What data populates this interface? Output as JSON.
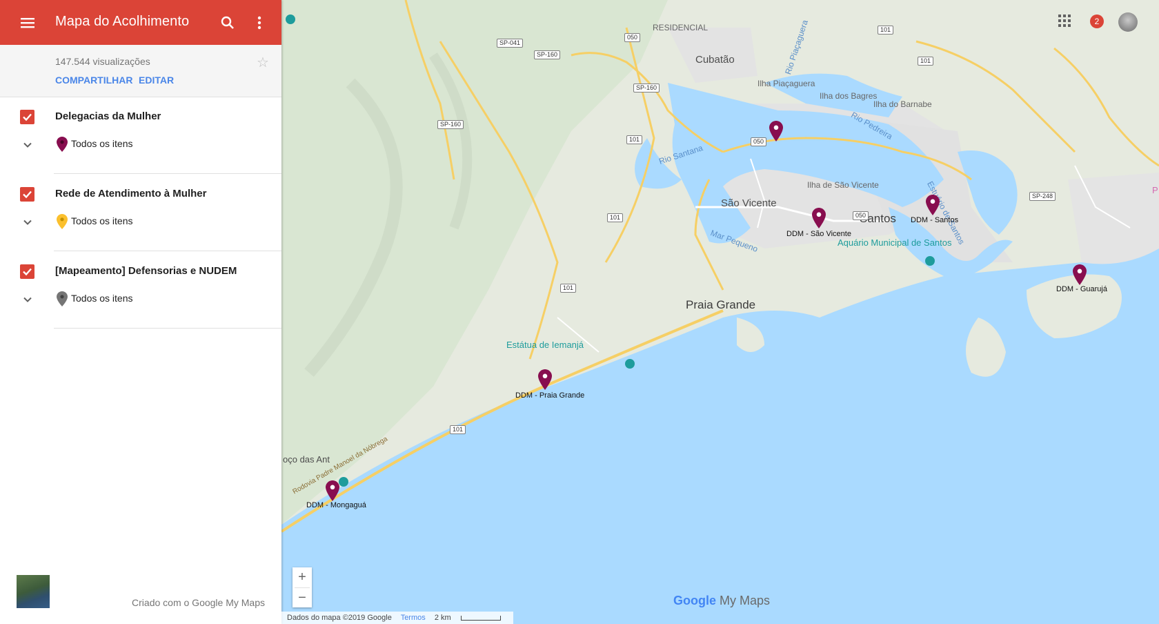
{
  "app": {
    "title": "Mapa do Acolhimento",
    "views": "147.544 visualizações",
    "share_label": "COMPARTILHAR",
    "edit_label": "EDITAR",
    "accent_color": "#db4437",
    "link_color": "#4a86e8"
  },
  "layers": [
    {
      "name": "Delegacias da Mulher",
      "items_label": "Todos os itens",
      "pin_color": "#880e4f",
      "checked": true
    },
    {
      "name": "Rede de Atendimento à Mulher",
      "items_label": "Todos os itens",
      "pin_color": "#fbc02d",
      "checked": true
    },
    {
      "name": "[Mapeamento] Defensorias e NUDEM",
      "items_label": "Todos os itens",
      "pin_color": "#757575",
      "checked": true
    }
  ],
  "sidebar_footer": {
    "credit": "Criado com o Google My Maps"
  },
  "header_controls": {
    "notification_count": "2"
  },
  "map": {
    "places": {
      "residencial": "RESIDENCIAL",
      "cubatao": "Cubatão",
      "ilha_piacaguera": "Ilha Piaçaguera",
      "ilha_bagres": "Ilha dos Bagres",
      "ilha_barnabe": "Ilha do Barnabe",
      "ilha_sao_vicente": "Ilha de São Vicente",
      "sao_vicente": "São Vicente",
      "santos": "Santos",
      "aquario": "Aquário Municipal de Santos",
      "praia_grande": "Praia Grande",
      "estatua": "Estátua de Iemanjá",
      "poco": "oço das Ant",
      "rio_santana": "Rio Santana",
      "rio_piacaguera": "Rio Piaçaguera",
      "rio_pedreira": "Rio Pedreira",
      "estuario": "Estuário de Santos",
      "mar_pequeno": "Mar Pequeno",
      "rodovia": "Rodovia Padre Manoel da Nóbrega",
      "p_edge": "P"
    },
    "road_shields": {
      "sp041": "SP-041",
      "sp160a": "SP-160",
      "sp160b": "SP-160",
      "sp160c": "SP-160",
      "sp248": "SP-248",
      "r050a": "050",
      "r050b": "050",
      "r050c": "050",
      "r101a": "101",
      "r101b": "101",
      "r101c": "101",
      "r101d": "101",
      "r101e": "101",
      "r101f": "101"
    },
    "markers": {
      "cubatao": "",
      "sao_vicente": "DDM - São Vicente",
      "santos": "DDM - Santos",
      "guaruja": "DDM - Guarujá",
      "praia_grande": "DDM - Praia Grande",
      "mongagua": "DDM - Mongaguá"
    },
    "zoom_in": "+",
    "zoom_out": "−",
    "brand_google": "Google",
    "brand_mymaps": "My Maps",
    "footer": {
      "attribution": "Dados do mapa ©2019 Google",
      "terms": "Termos",
      "scale": "2 km"
    }
  }
}
